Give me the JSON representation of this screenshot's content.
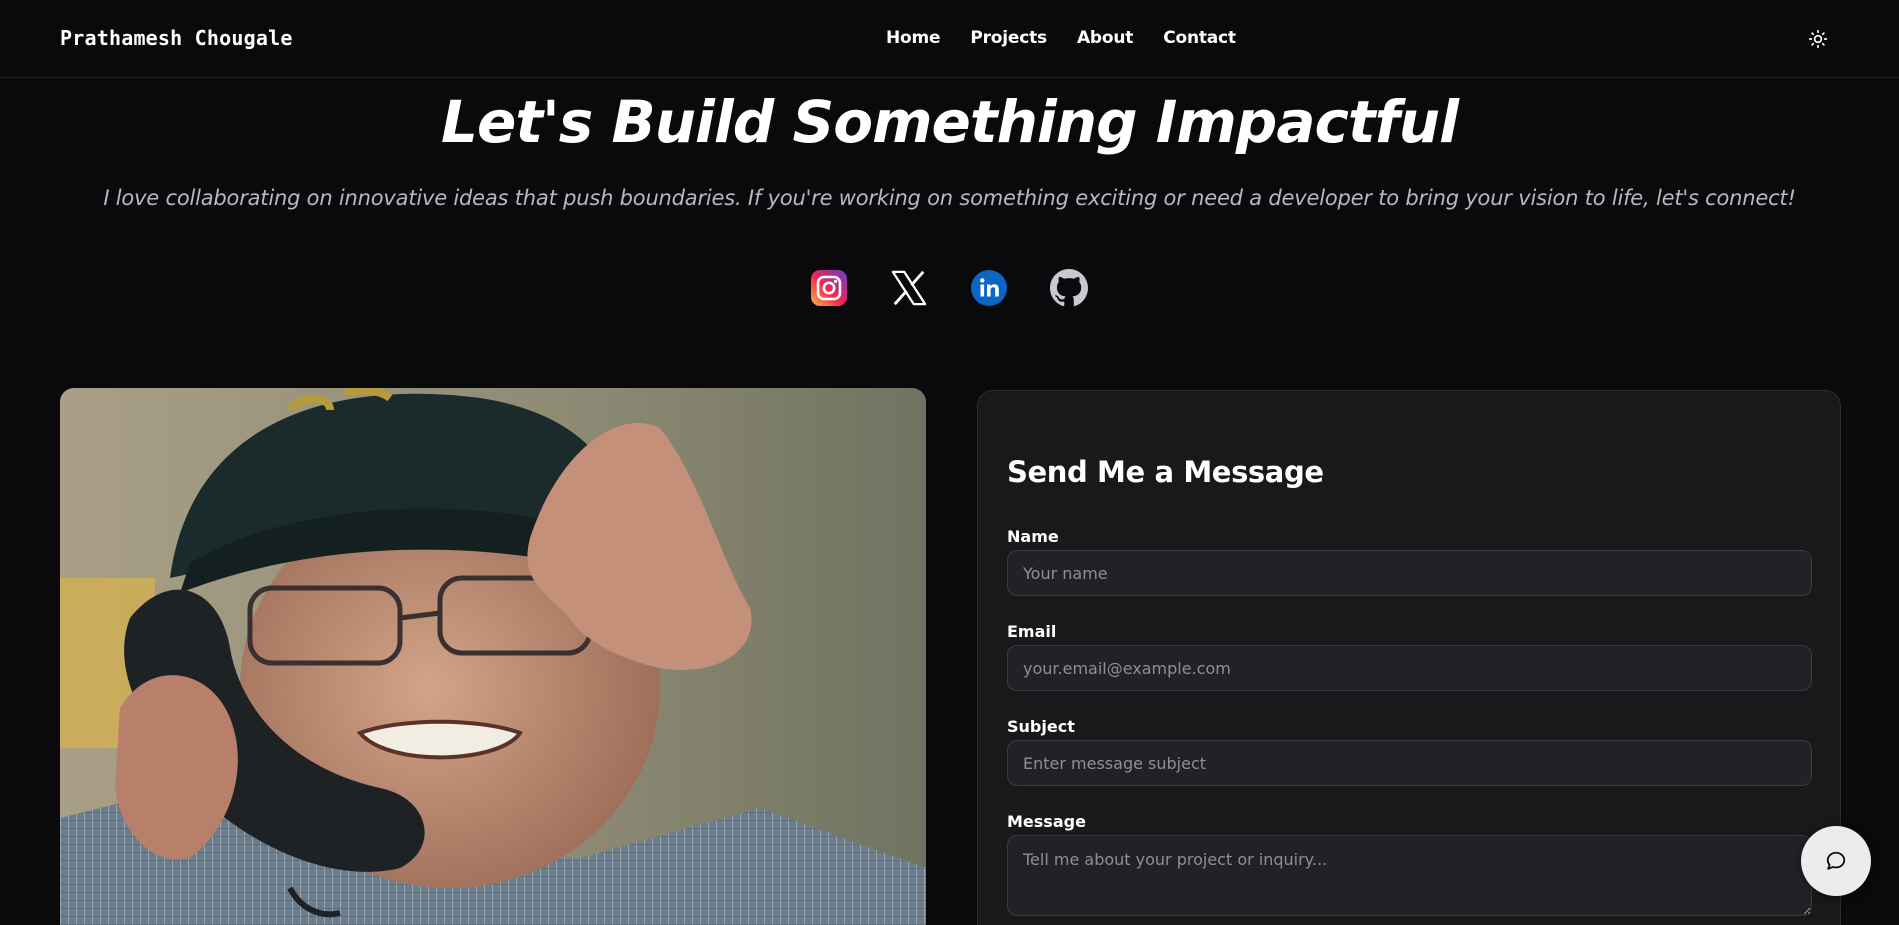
{
  "header": {
    "brand": "Prathamesh Chougale",
    "nav": [
      "Home",
      "Projects",
      "About",
      "Contact"
    ],
    "theme_toggle_icon": "sun-icon"
  },
  "hero": {
    "title": "Let's Build Something Impactful",
    "subtitle": "I love collaborating on innovative ideas that push boundaries. If you're working on something exciting or need a developer to bring your vision to life, let's connect!"
  },
  "socials": [
    {
      "name": "instagram",
      "icon": "instagram-icon"
    },
    {
      "name": "x",
      "icon": "x-icon"
    },
    {
      "name": "linkedin",
      "icon": "linkedin-icon"
    },
    {
      "name": "github",
      "icon": "github-icon"
    }
  ],
  "image": {
    "icon": "contact-gif-image"
  },
  "form": {
    "title": "Send Me a Message",
    "fields": {
      "name": {
        "label": "Name",
        "placeholder": "Your name"
      },
      "email": {
        "label": "Email",
        "placeholder": "your.email@example.com"
      },
      "subject": {
        "label": "Subject",
        "placeholder": "Enter message subject"
      },
      "message": {
        "label": "Message",
        "placeholder": "Tell me about your project or inquiry..."
      }
    }
  },
  "chat": {
    "icon": "chat-bubble-icon"
  },
  "colors": {
    "background": "#0a0a0c",
    "card": "#19191c",
    "input": "#222226",
    "linkedin": "#0a66c2"
  }
}
